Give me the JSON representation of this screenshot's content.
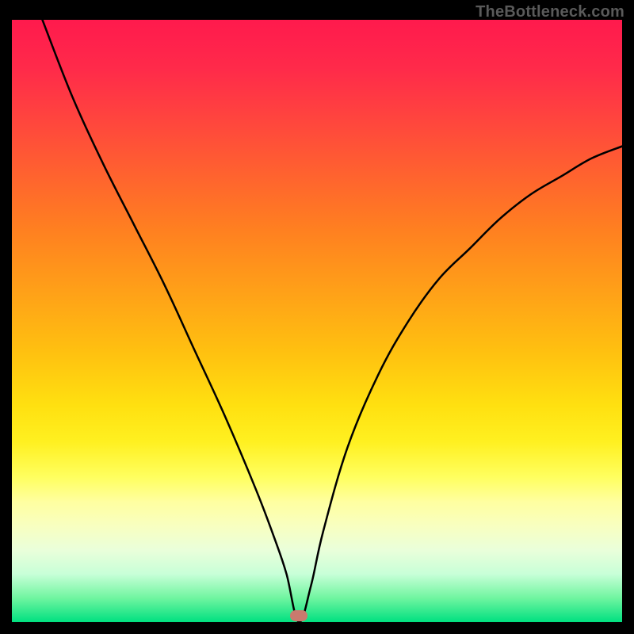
{
  "watermark": "TheBottleneck.com",
  "marker": {
    "x_pct": 47,
    "y_pct": 99
  },
  "chart_data": {
    "type": "line",
    "title": "",
    "xlabel": "",
    "ylabel": "",
    "xlim": [
      0,
      100
    ],
    "ylim": [
      0,
      100
    ],
    "grid": false,
    "series": [
      {
        "name": "bottleneck-curve",
        "x": [
          5,
          10,
          15,
          20,
          25,
          30,
          35,
          40,
          43,
          45,
          47,
          49,
          51,
          55,
          60,
          65,
          70,
          75,
          80,
          85,
          90,
          95,
          100
        ],
        "y": [
          100,
          87,
          76,
          66,
          56,
          45,
          34,
          22,
          14,
          8,
          0,
          6,
          15,
          29,
          41,
          50,
          57,
          62,
          67,
          71,
          74,
          77,
          79
        ]
      }
    ],
    "annotations": [
      {
        "type": "marker",
        "x": 47,
        "y": 0,
        "shape": "pill",
        "color": "#c97a6e"
      }
    ],
    "background": {
      "type": "vertical-gradient",
      "stops": [
        {
          "pct": 0,
          "color": "#ff1a4d"
        },
        {
          "pct": 50,
          "color": "#ffb010"
        },
        {
          "pct": 78,
          "color": "#ffff70"
        },
        {
          "pct": 100,
          "color": "#00e080"
        }
      ]
    }
  }
}
